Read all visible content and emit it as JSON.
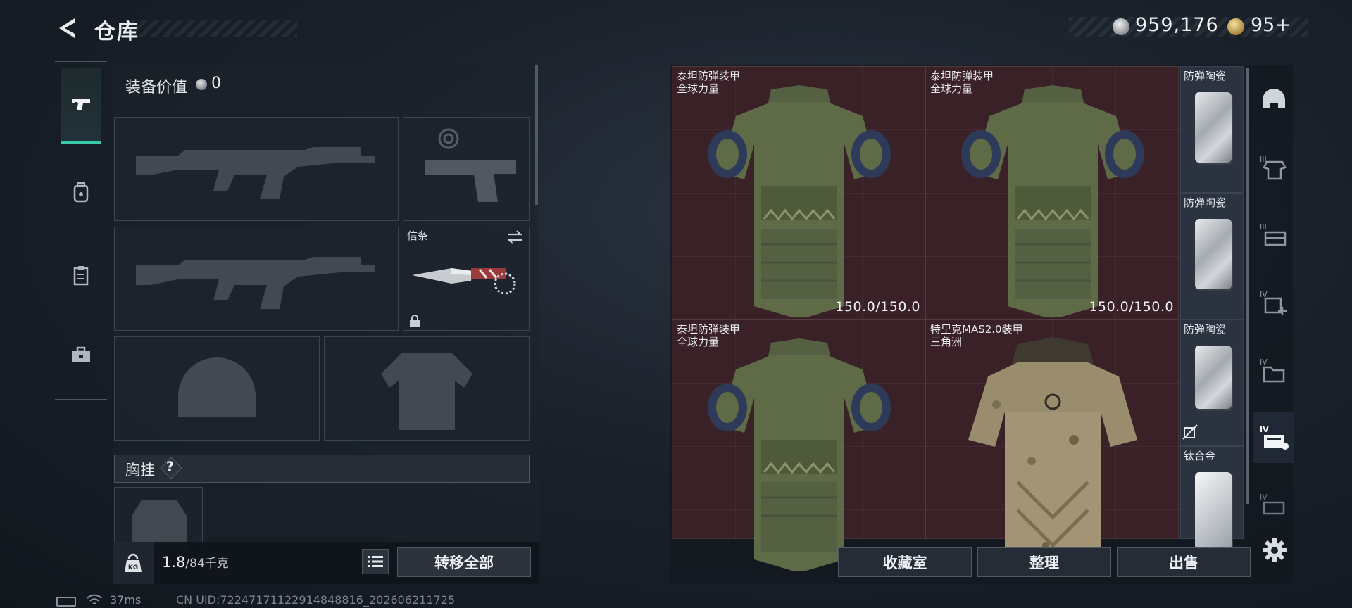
{
  "header": {
    "title": "仓库",
    "currency_primary": "959,176",
    "currency_secondary": "95+",
    "corner_mark": "..."
  },
  "left_rail": {
    "tabs": [
      {
        "icon": "pistol-icon",
        "active": true
      },
      {
        "icon": "backpack-icon",
        "active": false
      },
      {
        "icon": "clipboard-icon",
        "active": false
      },
      {
        "icon": "toolbox-icon",
        "active": false
      }
    ]
  },
  "loadout": {
    "equip_value_label": "装备价值",
    "equip_value": "0",
    "melee_label": "信条",
    "chest_rig_label": "胸挂",
    "help_glyph": "?",
    "weight_current": "1.8",
    "weight_max": "/84千克",
    "transfer_all": "转移全部"
  },
  "status": {
    "ping": "37ms",
    "uid": "CN UID:7224717112291484881​6_202606211725"
  },
  "inventory": {
    "items": [
      {
        "name_line1": "泰坦防弹装甲",
        "name_line2": "全球力量",
        "durability": "150.0/150.0"
      },
      {
        "name_line1": "泰坦防弹装甲",
        "name_line2": "全球力量",
        "durability": "150.0/150.0"
      },
      {
        "name_line1": "泰坦防弹装甲",
        "name_line2": "全球力量",
        "durability": ""
      },
      {
        "name_line1": "特里克MAS2.0装甲",
        "name_line2": "三角洲",
        "durability": ""
      }
    ],
    "plates": [
      {
        "name": "防弹陶瓷"
      },
      {
        "name": "防弹陶瓷"
      },
      {
        "name": "防弹陶瓷"
      },
      {
        "name": "钛合金"
      }
    ]
  },
  "right_rail": {
    "tabs": [
      {
        "icon": "helmet-icon",
        "active": false
      },
      {
        "icon": "armor-tier3-icon",
        "active": false
      },
      {
        "icon": "rig-tier3-icon",
        "active": false
      },
      {
        "icon": "medkit-tier4-icon",
        "active": false
      },
      {
        "icon": "folder-tier4-icon",
        "active": false
      },
      {
        "icon": "armor-tier4-icon",
        "active": true
      },
      {
        "icon": "weapon-tier4-icon",
        "active": false
      }
    ]
  },
  "actions": {
    "collection": "收藏室",
    "sort": "整理",
    "sell": "出售"
  },
  "colors": {
    "accent": "#38c9a8",
    "grid_bg": "#3a2128",
    "armor_green": "#5f6b46"
  }
}
